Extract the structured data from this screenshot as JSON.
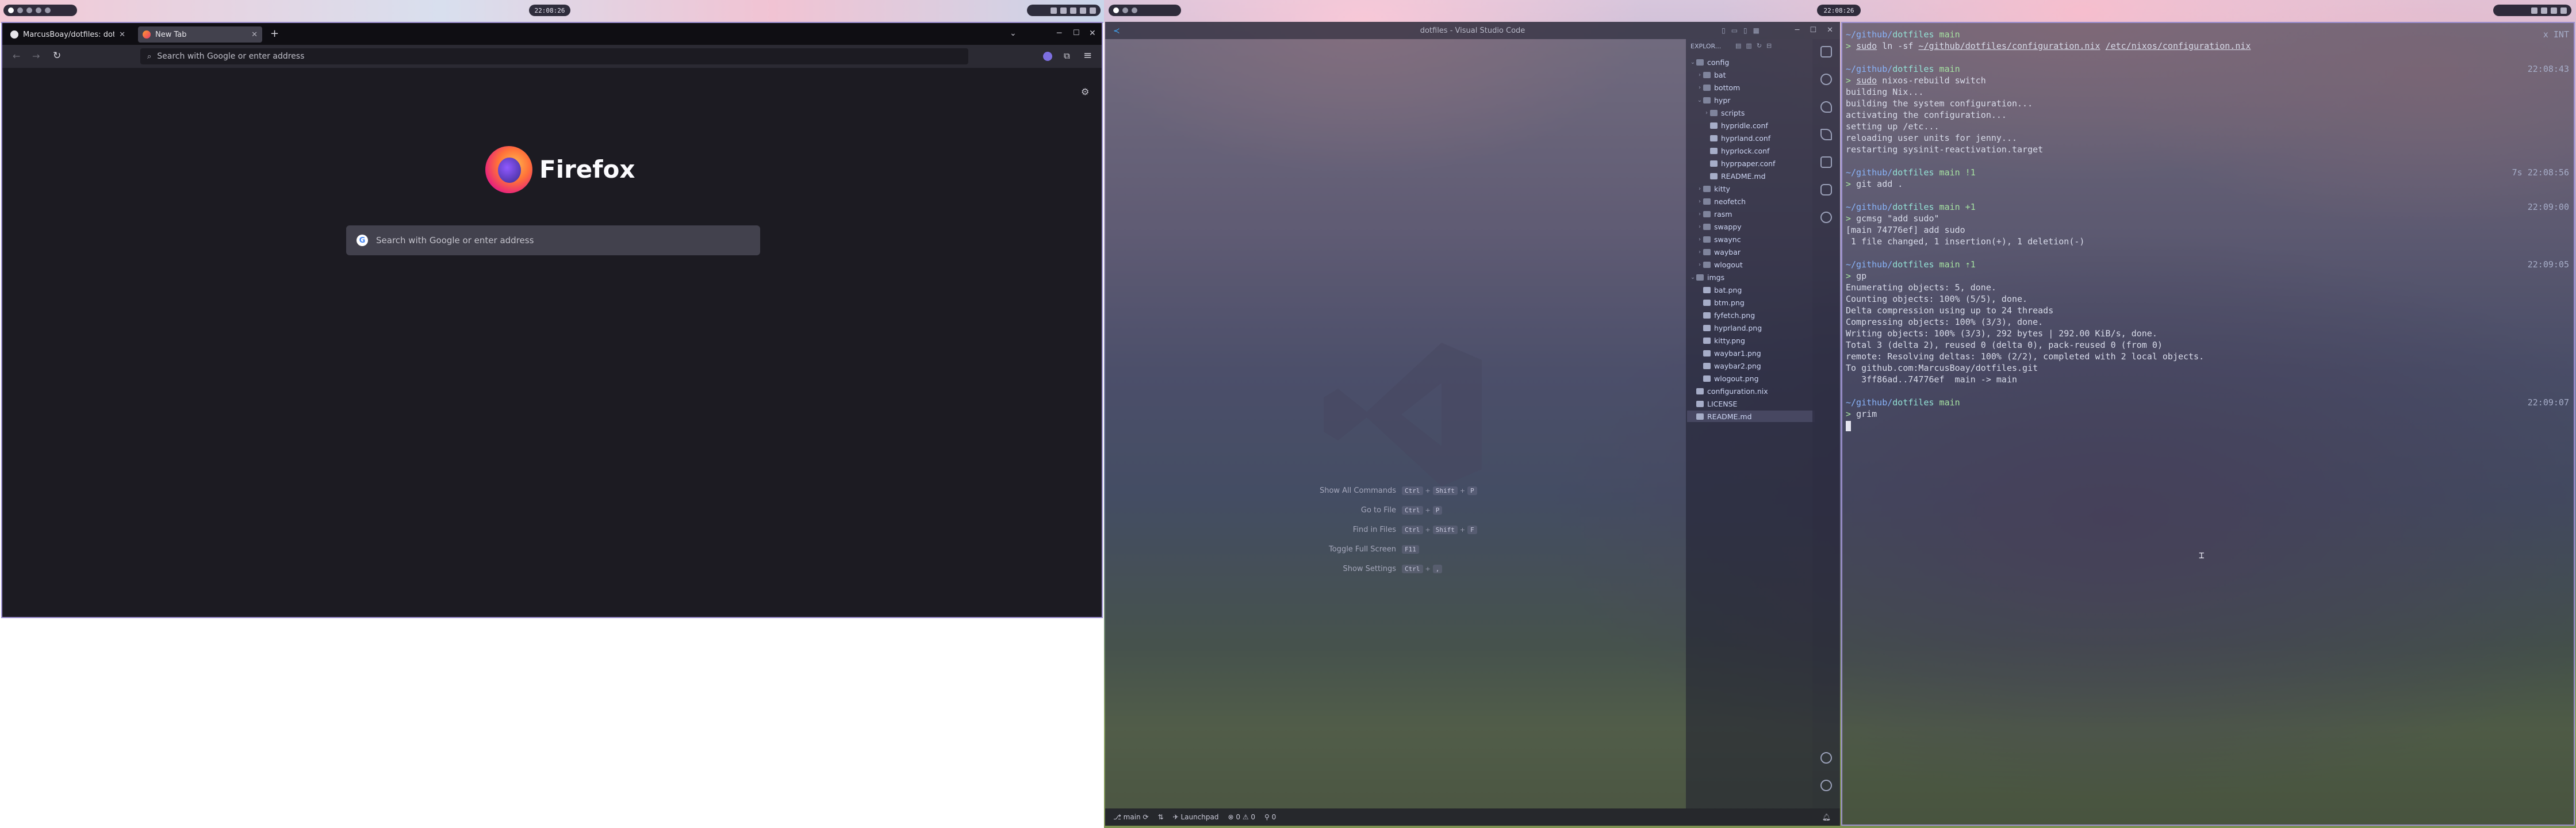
{
  "topbar": {
    "clock": "22:08:26",
    "workspaces": [
      "1",
      "2",
      "3",
      "4",
      "5"
    ]
  },
  "firefox": {
    "tabs": [
      {
        "label": "MarcusBoay/dotfiles: dot",
        "active": false
      },
      {
        "label": "New Tab",
        "active": true
      }
    ],
    "url_placeholder": "Search with Google or enter address",
    "logo_text": "Firefox",
    "search_placeholder": "Search with Google or enter address",
    "colors": {
      "background": "#1c1b22",
      "toolbar": "#2b2a33",
      "search": "#42414d"
    }
  },
  "vscode": {
    "title": "dotfiles - Visual Studio Code",
    "explorer_label": "EXPLOR...",
    "tree": [
      {
        "label": "config",
        "type": "folder",
        "depth": 0,
        "open": true
      },
      {
        "label": "bat",
        "type": "folder",
        "depth": 1
      },
      {
        "label": "bottom",
        "type": "folder",
        "depth": 1
      },
      {
        "label": "hypr",
        "type": "folder",
        "depth": 1,
        "open": true
      },
      {
        "label": "scripts",
        "type": "folder",
        "depth": 2
      },
      {
        "label": "hypridle.conf",
        "type": "file",
        "depth": 2
      },
      {
        "label": "hyprland.conf",
        "type": "file",
        "depth": 2
      },
      {
        "label": "hyprlock.conf",
        "type": "file",
        "depth": 2
      },
      {
        "label": "hyprpaper.conf",
        "type": "file",
        "depth": 2
      },
      {
        "label": "README.md",
        "type": "file",
        "depth": 2
      },
      {
        "label": "kitty",
        "type": "folder",
        "depth": 1
      },
      {
        "label": "neofetch",
        "type": "folder",
        "depth": 1
      },
      {
        "label": "rasm",
        "type": "folder",
        "depth": 1
      },
      {
        "label": "swappy",
        "type": "folder",
        "depth": 1
      },
      {
        "label": "swaync",
        "type": "folder",
        "depth": 1
      },
      {
        "label": "waybar",
        "type": "folder",
        "depth": 1
      },
      {
        "label": "wlogout",
        "type": "folder",
        "depth": 1
      },
      {
        "label": "imgs",
        "type": "folder",
        "depth": 0,
        "open": true
      },
      {
        "label": "bat.png",
        "type": "file",
        "depth": 1
      },
      {
        "label": "btm.png",
        "type": "file",
        "depth": 1
      },
      {
        "label": "fyfetch.png",
        "type": "file",
        "depth": 1
      },
      {
        "label": "hyprland.png",
        "type": "file",
        "depth": 1
      },
      {
        "label": "kitty.png",
        "type": "file",
        "depth": 1
      },
      {
        "label": "waybar1.png",
        "type": "file",
        "depth": 1
      },
      {
        "label": "waybar2.png",
        "type": "file",
        "depth": 1
      },
      {
        "label": "wlogout.png",
        "type": "file",
        "depth": 1
      },
      {
        "label": "configuration.nix",
        "type": "file",
        "depth": 0
      },
      {
        "label": "LICENSE",
        "type": "file",
        "depth": 0
      },
      {
        "label": "README.md",
        "type": "file",
        "depth": 0,
        "selected": true
      }
    ],
    "commands": [
      {
        "label": "Show All Commands",
        "keys": [
          "Ctrl",
          "Shift",
          "P"
        ]
      },
      {
        "label": "Go to File",
        "keys": [
          "Ctrl",
          "P"
        ]
      },
      {
        "label": "Find in Files",
        "keys": [
          "Ctrl",
          "Shift",
          "F"
        ]
      },
      {
        "label": "Toggle Full Screen",
        "keys": [
          "F11"
        ]
      },
      {
        "label": "Show Settings",
        "keys": [
          "Ctrl",
          ","
        ]
      }
    ],
    "status": {
      "branch": "main",
      "launchpad": "Launchpad",
      "problems": "0 ⚠ 0",
      "ports": "0"
    }
  },
  "terminal": {
    "lines": [
      {
        "parts": [
          {
            "t": "~/github/",
            "c": "blue"
          },
          {
            "t": "dotfiles",
            "c": "cyan"
          },
          {
            "t": " main",
            "c": "green"
          }
        ],
        "right": "x INT",
        "right_class": "red"
      },
      {
        "parts": [
          {
            "t": "> ",
            "c": "green"
          },
          {
            "t": "sudo",
            "c": "ul"
          },
          {
            "t": " ln -sf "
          },
          {
            "t": "~/github/dotfiles/configuration.nix",
            "c": "ul"
          },
          {
            "t": " "
          },
          {
            "t": "/etc/nixos/configuration.nix",
            "c": "ul"
          }
        ]
      },
      {
        "parts": []
      },
      {
        "parts": [
          {
            "t": "~/github/",
            "c": "blue"
          },
          {
            "t": "dotfiles",
            "c": "cyan"
          },
          {
            "t": " main",
            "c": "green"
          }
        ],
        "right": "22:08:43"
      },
      {
        "parts": [
          {
            "t": "> ",
            "c": "green"
          },
          {
            "t": "sudo",
            "c": "ul"
          },
          {
            "t": " nixos-rebuild switch"
          }
        ]
      },
      {
        "parts": [
          {
            "t": "building Nix..."
          }
        ]
      },
      {
        "parts": [
          {
            "t": "building the system configuration..."
          }
        ]
      },
      {
        "parts": [
          {
            "t": "activating the configuration..."
          }
        ]
      },
      {
        "parts": [
          {
            "t": "setting up /etc..."
          }
        ]
      },
      {
        "parts": [
          {
            "t": "reloading user units for jenny..."
          }
        ]
      },
      {
        "parts": [
          {
            "t": "restarting sysinit-reactivation.target"
          }
        ]
      },
      {
        "parts": []
      },
      {
        "parts": [
          {
            "t": "~/github/",
            "c": "blue"
          },
          {
            "t": "dotfiles",
            "c": "cyan"
          },
          {
            "t": " main !1",
            "c": "green"
          }
        ],
        "right": "7s 22:08:56"
      },
      {
        "parts": [
          {
            "t": "> ",
            "c": "green"
          },
          {
            "t": "git add ."
          }
        ]
      },
      {
        "parts": []
      },
      {
        "parts": [
          {
            "t": "~/github/",
            "c": "blue"
          },
          {
            "t": "dotfiles",
            "c": "cyan"
          },
          {
            "t": " main +1",
            "c": "green"
          }
        ],
        "right": "22:09:00"
      },
      {
        "parts": [
          {
            "t": "> ",
            "c": "green"
          },
          {
            "t": "gcmsg \"add sudo\""
          }
        ]
      },
      {
        "parts": [
          {
            "t": "[main 74776ef] add sudo"
          }
        ]
      },
      {
        "parts": [
          {
            "t": " 1 file changed, 1 insertion(+), 1 deletion(-)"
          }
        ]
      },
      {
        "parts": []
      },
      {
        "parts": [
          {
            "t": "~/github/",
            "c": "blue"
          },
          {
            "t": "dotfiles",
            "c": "cyan"
          },
          {
            "t": " main ⇡1",
            "c": "green"
          }
        ],
        "right": "22:09:05"
      },
      {
        "parts": [
          {
            "t": "> ",
            "c": "green"
          },
          {
            "t": "gp"
          }
        ]
      },
      {
        "parts": [
          {
            "t": "Enumerating objects: 5, done."
          }
        ]
      },
      {
        "parts": [
          {
            "t": "Counting objects: 100% (5/5), done."
          }
        ]
      },
      {
        "parts": [
          {
            "t": "Delta compression using up to 24 threads"
          }
        ]
      },
      {
        "parts": [
          {
            "t": "Compressing objects: 100% (3/3), done."
          }
        ]
      },
      {
        "parts": [
          {
            "t": "Writing objects: 100% (3/3), 292 bytes | 292.00 KiB/s, done."
          }
        ]
      },
      {
        "parts": [
          {
            "t": "Total 3 (delta 2), reused 0 (delta 0), pack-reused 0 (from 0)"
          }
        ]
      },
      {
        "parts": [
          {
            "t": "remote: Resolving deltas: 100% (2/2), completed with 2 local objects."
          }
        ]
      },
      {
        "parts": [
          {
            "t": "To github.com:MarcusBoay/dotfiles.git"
          }
        ]
      },
      {
        "parts": [
          {
            "t": "   3ff86ad..74776ef  main -> main"
          }
        ]
      },
      {
        "parts": []
      },
      {
        "parts": [
          {
            "t": "~/github/",
            "c": "blue"
          },
          {
            "t": "dotfiles",
            "c": "cyan"
          },
          {
            "t": " main",
            "c": "green"
          }
        ],
        "right": "22:09:07"
      },
      {
        "parts": [
          {
            "t": "> ",
            "c": "green"
          },
          {
            "t": "grim"
          }
        ]
      }
    ]
  }
}
